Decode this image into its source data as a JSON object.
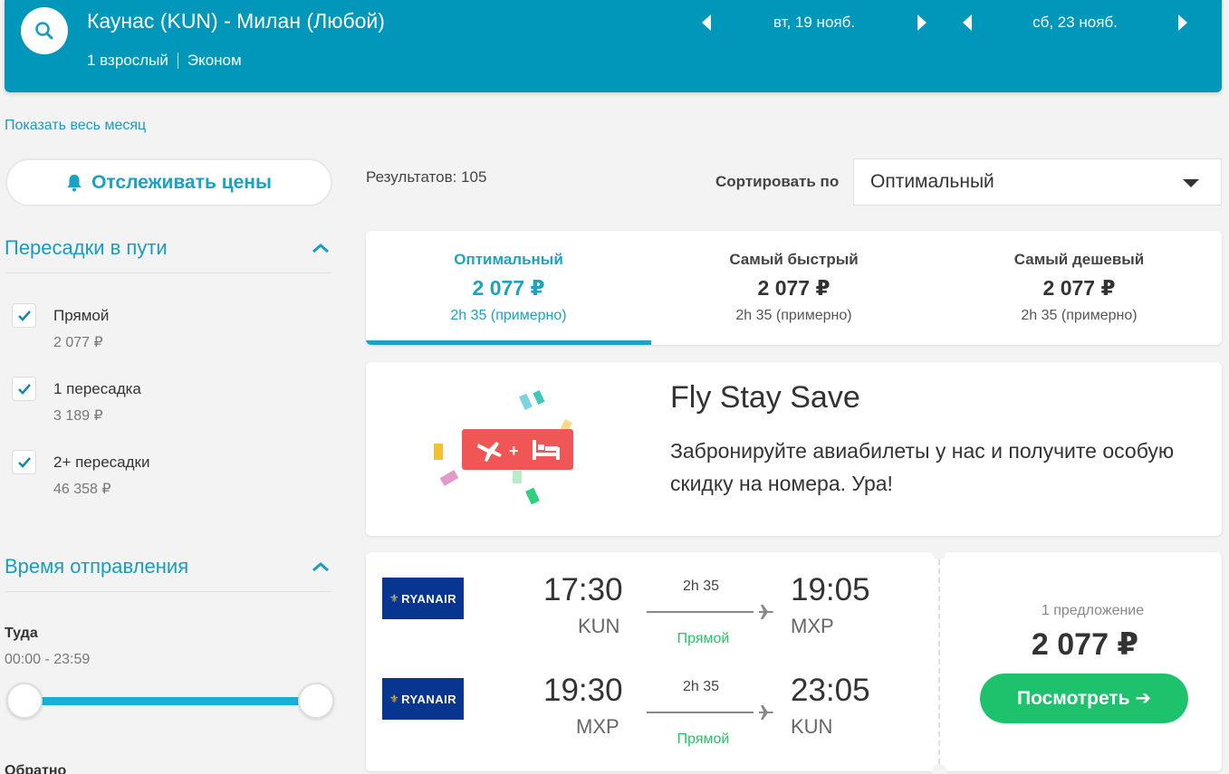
{
  "header": {
    "route": "Каунас (KUN) - Милан (Любой)",
    "passengers": "1 взрослый",
    "cabin": "Эконом",
    "depart_date": "вт, 19 нояб.",
    "return_date": "сб, 23 нояб.",
    "color": "#0097ba"
  },
  "sidebar": {
    "show_month": "Показать весь месяц",
    "track_prices": "Отслеживать цены",
    "stops_title": "Пересадки в пути",
    "stops": [
      {
        "label": "Прямой",
        "price": "2 077 ₽",
        "checked": true
      },
      {
        "label": "1 пересадка",
        "price": "3 189 ₽",
        "checked": true
      },
      {
        "label": "2+ пересадки",
        "price": "46 358 ₽",
        "checked": true
      }
    ],
    "departure_title": "Время отправления",
    "outbound_label": "Туда",
    "outbound_range": "00:00 - 23:59",
    "return_label": "Обратно"
  },
  "results": {
    "count": "Результатов: 105",
    "sort_label": "Сортировать по",
    "sort_value": "Оптимальный"
  },
  "tabs": [
    {
      "title": "Оптимальный",
      "price": "2 077 ₽",
      "duration": "2h 35 (примерно)",
      "active": true
    },
    {
      "title": "Самый быстрый",
      "price": "2 077 ₽",
      "duration": "2h 35 (примерно)",
      "active": false
    },
    {
      "title": "Самый дешевый",
      "price": "2 077 ₽",
      "duration": "2h 35 (примерно)",
      "active": false
    }
  ],
  "promo": {
    "title": "Fly Stay Save",
    "text": "Забронируйте авиабилеты у нас и получите особую скидку на номера. Ура!"
  },
  "flight": {
    "legs": [
      {
        "airline": "RYANAIR",
        "dep_time": "17:30",
        "dep_code": "KUN",
        "duration": "2h 35",
        "stops": "Прямой",
        "arr_time": "19:05",
        "arr_code": "MXP"
      },
      {
        "airline": "RYANAIR",
        "dep_time": "19:30",
        "dep_code": "MXP",
        "duration": "2h 35",
        "stops": "Прямой",
        "arr_time": "23:05",
        "arr_code": "KUN"
      }
    ],
    "offers": "1 предложение",
    "price": "2 077 ₽",
    "view_button": "Посмотреть ➔"
  }
}
